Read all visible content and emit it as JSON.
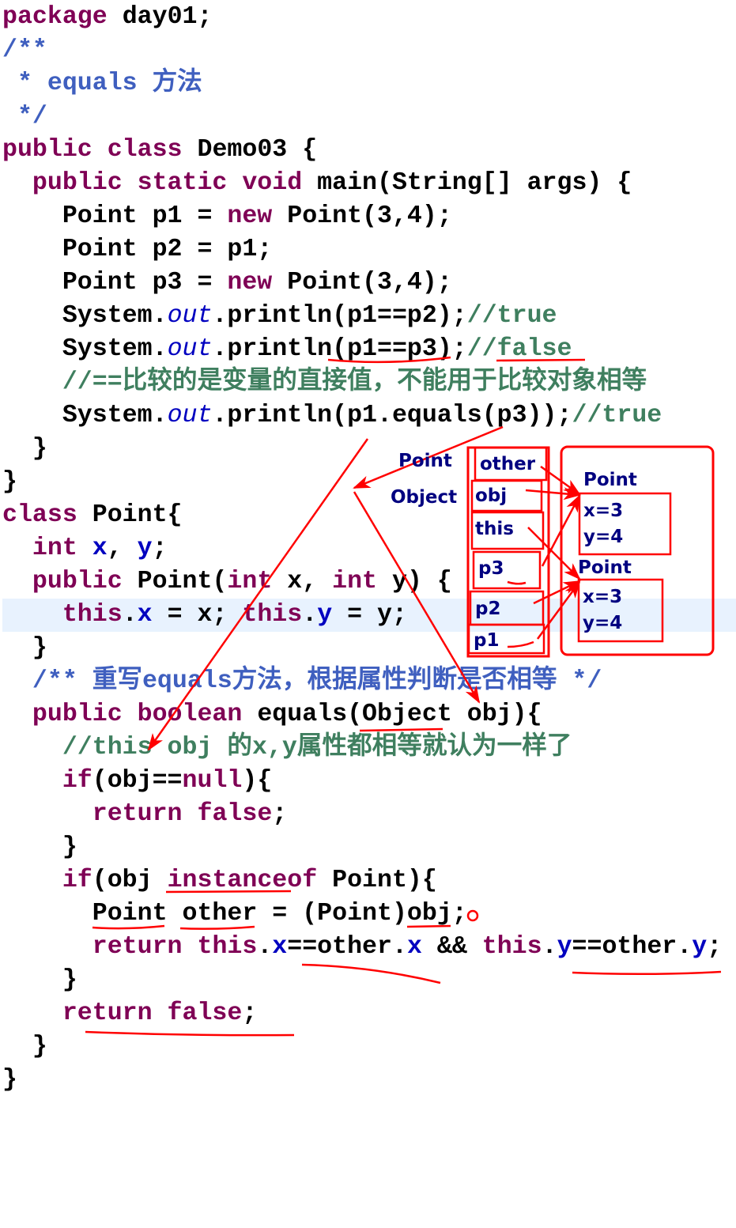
{
  "code": {
    "highlighted_line": 18,
    "lines": [
      [
        {
          "t": "kw",
          "s": "package "
        },
        {
          "t": "pl",
          "s": "day01;"
        }
      ],
      [
        {
          "t": "jd",
          "s": "/**"
        }
      ],
      [
        {
          "t": "jd",
          "s": " * equals 方法"
        }
      ],
      [
        {
          "t": "jd",
          "s": " */"
        }
      ],
      [
        {
          "t": "kw",
          "s": "public class "
        },
        {
          "t": "pl",
          "s": "Demo03 {"
        }
      ],
      [
        {
          "t": "pl",
          "s": "  "
        },
        {
          "t": "kw",
          "s": "public static void "
        },
        {
          "t": "pl",
          "s": "main(String[] args) {"
        }
      ],
      [
        {
          "t": "pl",
          "s": "    Point p1 = "
        },
        {
          "t": "kw",
          "s": "new "
        },
        {
          "t": "pl",
          "s": "Point(3,4);"
        }
      ],
      [
        {
          "t": "pl",
          "s": "    Point p2 = p1;"
        }
      ],
      [
        {
          "t": "pl",
          "s": "    Point p3 = "
        },
        {
          "t": "kw",
          "s": "new "
        },
        {
          "t": "pl",
          "s": "Point(3,4);"
        }
      ],
      [
        {
          "t": "pl",
          "s": "    System."
        },
        {
          "t": "st",
          "s": "out"
        },
        {
          "t": "pl",
          "s": ".println(p1==p2);"
        },
        {
          "t": "cm",
          "s": "//true"
        }
      ],
      [
        {
          "t": "pl",
          "s": "    System."
        },
        {
          "t": "st",
          "s": "out"
        },
        {
          "t": "pl",
          "s": ".println(p1==p3);"
        },
        {
          "t": "cm",
          "s": "//false"
        }
      ],
      [
        {
          "t": "pl",
          "s": "    "
        },
        {
          "t": "cm",
          "s": "//==比较的是变量的直接值，不能用于比较对象相等"
        }
      ],
      [
        {
          "t": "pl",
          "s": "    System."
        },
        {
          "t": "st",
          "s": "out"
        },
        {
          "t": "pl",
          "s": ".println(p1.equals(p3));"
        },
        {
          "t": "cm",
          "s": "//true"
        }
      ],
      [
        {
          "t": "pl",
          "s": "  }"
        }
      ],
      [
        {
          "t": "pl",
          "s": "}"
        }
      ],
      [
        {
          "t": "kw",
          "s": "class "
        },
        {
          "t": "pl",
          "s": "Point{"
        }
      ],
      [
        {
          "t": "pl",
          "s": "  "
        },
        {
          "t": "kw",
          "s": "int "
        },
        {
          "t": "fd",
          "s": "x"
        },
        {
          "t": "pl",
          "s": ", "
        },
        {
          "t": "fd",
          "s": "y"
        },
        {
          "t": "pl",
          "s": ";"
        }
      ],
      [
        {
          "t": "pl",
          "s": "  "
        },
        {
          "t": "kw",
          "s": "public "
        },
        {
          "t": "pl",
          "s": "Point("
        },
        {
          "t": "kw",
          "s": "int "
        },
        {
          "t": "pl",
          "s": "x, "
        },
        {
          "t": "kw",
          "s": "int "
        },
        {
          "t": "pl",
          "s": "y) {"
        }
      ],
      [
        {
          "t": "pl",
          "s": "    "
        },
        {
          "t": "kw",
          "s": "this"
        },
        {
          "t": "pl",
          "s": "."
        },
        {
          "t": "fd",
          "s": "x"
        },
        {
          "t": "pl",
          "s": " = x; "
        },
        {
          "t": "kw",
          "s": "this"
        },
        {
          "t": "pl",
          "s": "."
        },
        {
          "t": "fd",
          "s": "y"
        },
        {
          "t": "pl",
          "s": " = y;"
        }
      ],
      [
        {
          "t": "pl",
          "s": "  }"
        }
      ],
      [
        {
          "t": "pl",
          "s": "  "
        },
        {
          "t": "jd",
          "s": "/** 重写equals方法，根据属性判断是否相等 */"
        }
      ],
      [
        {
          "t": "pl",
          "s": "  "
        },
        {
          "t": "kw",
          "s": "public boolean "
        },
        {
          "t": "pl",
          "s": "equals(Object obj){"
        }
      ],
      [
        {
          "t": "pl",
          "s": "    "
        },
        {
          "t": "cm",
          "s": "//this obj 的x,y属性都相等就认为一样了"
        }
      ],
      [
        {
          "t": "pl",
          "s": "    "
        },
        {
          "t": "kw",
          "s": "if"
        },
        {
          "t": "pl",
          "s": "(obj=="
        },
        {
          "t": "kw",
          "s": "null"
        },
        {
          "t": "pl",
          "s": "){"
        }
      ],
      [
        {
          "t": "pl",
          "s": "      "
        },
        {
          "t": "kw",
          "s": "return false"
        },
        {
          "t": "pl",
          "s": ";"
        }
      ],
      [
        {
          "t": "pl",
          "s": "    }"
        }
      ],
      [
        {
          "t": "pl",
          "s": "    "
        },
        {
          "t": "kw",
          "s": "if"
        },
        {
          "t": "pl",
          "s": "(obj "
        },
        {
          "t": "kw",
          "s": "instanceof "
        },
        {
          "t": "pl",
          "s": "Point){"
        }
      ],
      [
        {
          "t": "pl",
          "s": "      Point other = (Point)obj;"
        }
      ],
      [
        {
          "t": "pl",
          "s": "      "
        },
        {
          "t": "kw",
          "s": "return this"
        },
        {
          "t": "pl",
          "s": "."
        },
        {
          "t": "fd",
          "s": "x"
        },
        {
          "t": "pl",
          "s": "==other."
        },
        {
          "t": "fd",
          "s": "x"
        },
        {
          "t": "pl",
          "s": " && "
        },
        {
          "t": "kw",
          "s": "this"
        },
        {
          "t": "pl",
          "s": "."
        },
        {
          "t": "fd",
          "s": "y"
        },
        {
          "t": "pl",
          "s": "==other."
        },
        {
          "t": "fd",
          "s": "y"
        },
        {
          "t": "pl",
          "s": ";"
        }
      ],
      [
        {
          "t": "pl",
          "s": "    }"
        }
      ],
      [
        {
          "t": "pl",
          "s": "    "
        },
        {
          "t": "kw",
          "s": "return false"
        },
        {
          "t": "pl",
          "s": ";"
        }
      ],
      [
        {
          "t": "pl",
          "s": "  }"
        }
      ],
      [
        {
          "t": "pl",
          "s": "}"
        }
      ]
    ]
  },
  "diagram": {
    "type_labels": {
      "point": "Point",
      "object": "Object"
    },
    "stack": [
      "other",
      "obj",
      "this",
      "p3",
      "p2",
      "p1"
    ],
    "heap": [
      {
        "class": "Point",
        "x": "x=3",
        "y": "y=4"
      },
      {
        "class": "Point",
        "x": "x=3",
        "y": "y=4"
      }
    ],
    "colors": {
      "annotation": "#ff0000",
      "label": "#000080",
      "keyword": "#7f0055",
      "javadoc": "#3f5fbf",
      "comment": "#3f7f5f",
      "field": "#0000c0"
    }
  }
}
